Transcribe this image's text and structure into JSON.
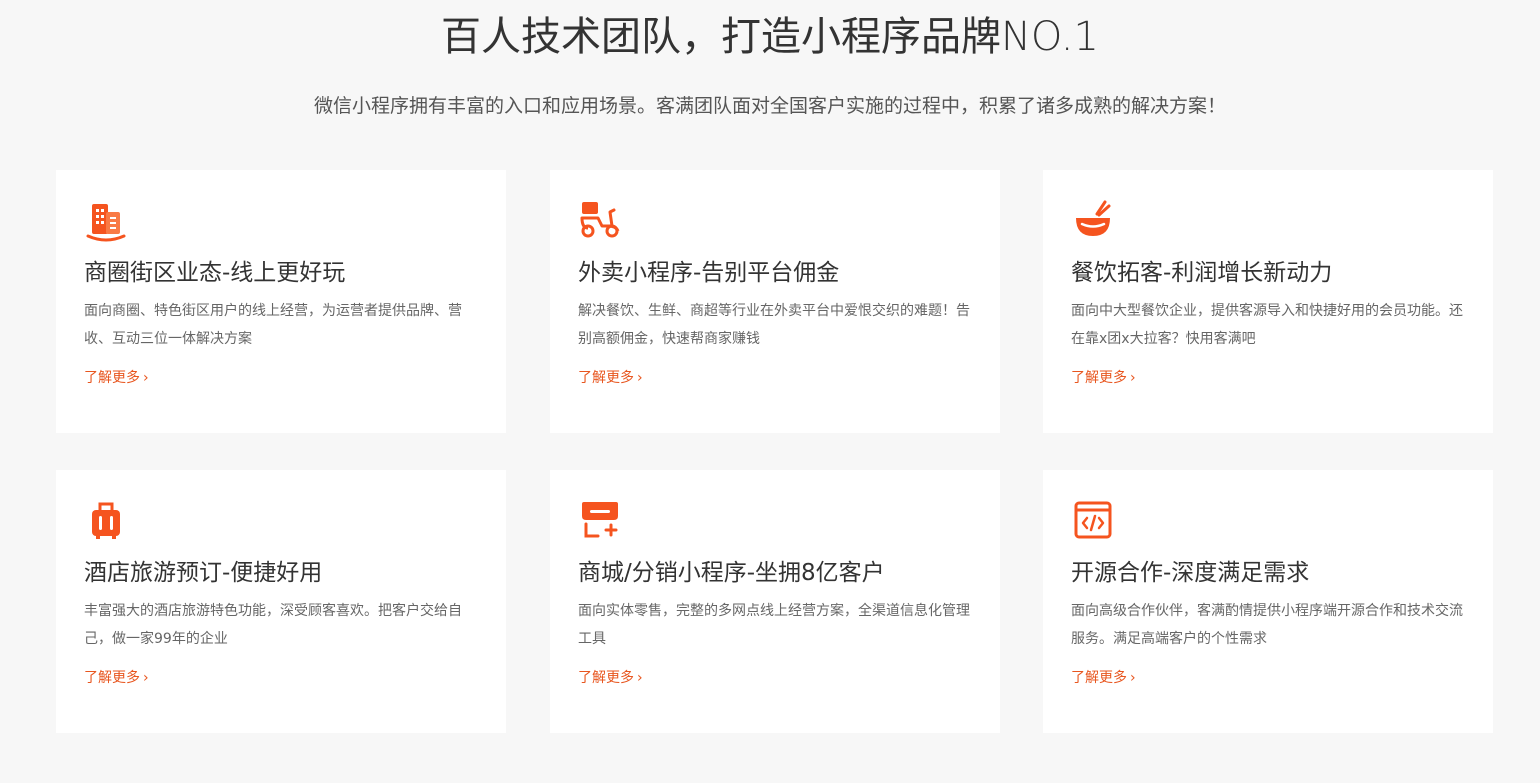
{
  "header": {
    "title": "百人技术团队，打造小程序品牌NO.1",
    "subtitle": "微信小程序拥有丰富的入口和应用场景。客满团队面对全国客户实施的过程中，积累了诸多成熟的解决方案！"
  },
  "accent_color": "#f5541f",
  "cards": [
    {
      "icon": "buildings-icon",
      "title": "商圈街区业态-线上更好玩",
      "desc": "面向商圈、特色街区用户的线上经营，为运营者提供品牌、营收、互动三位一体解决方案",
      "more": "了解更多",
      "chevron": "›"
    },
    {
      "icon": "scooter-icon",
      "title": "外卖小程序-告别平台佣金",
      "desc": "解决餐饮、生鲜、商超等行业在外卖平台中爱恨交织的难题！告别高额佣金，快速帮商家赚钱",
      "more": "了解更多",
      "chevron": "›"
    },
    {
      "icon": "bowl-chopsticks-icon",
      "title": "餐饮拓客-利润增长新动力",
      "desc": "面向中大型餐饮企业，提供客源导入和快捷好用的会员功能。还在靠x团x大拉客？快用客满吧",
      "more": "了解更多",
      "chevron": "›"
    },
    {
      "icon": "luggage-icon",
      "title": "酒店旅游预订-便捷好用",
      "desc": "丰富强大的酒店旅游特色功能，深受顾客喜欢。把客户交给自己，做一家99年的企业",
      "more": "了解更多",
      "chevron": "›"
    },
    {
      "icon": "storefront-icon",
      "title": "商城/分销小程序-坐拥8亿客户",
      "desc": "面向实体零售，完整的多网点线上经营方案，全渠道信息化管理工具",
      "more": "了解更多",
      "chevron": "›"
    },
    {
      "icon": "code-window-icon",
      "title": "开源合作-深度满足需求",
      "desc": "面向高级合作伙伴，客满酌情提供小程序端开源合作和技术交流服务。满足高端客户的个性需求",
      "more": "了解更多",
      "chevron": "›"
    }
  ]
}
